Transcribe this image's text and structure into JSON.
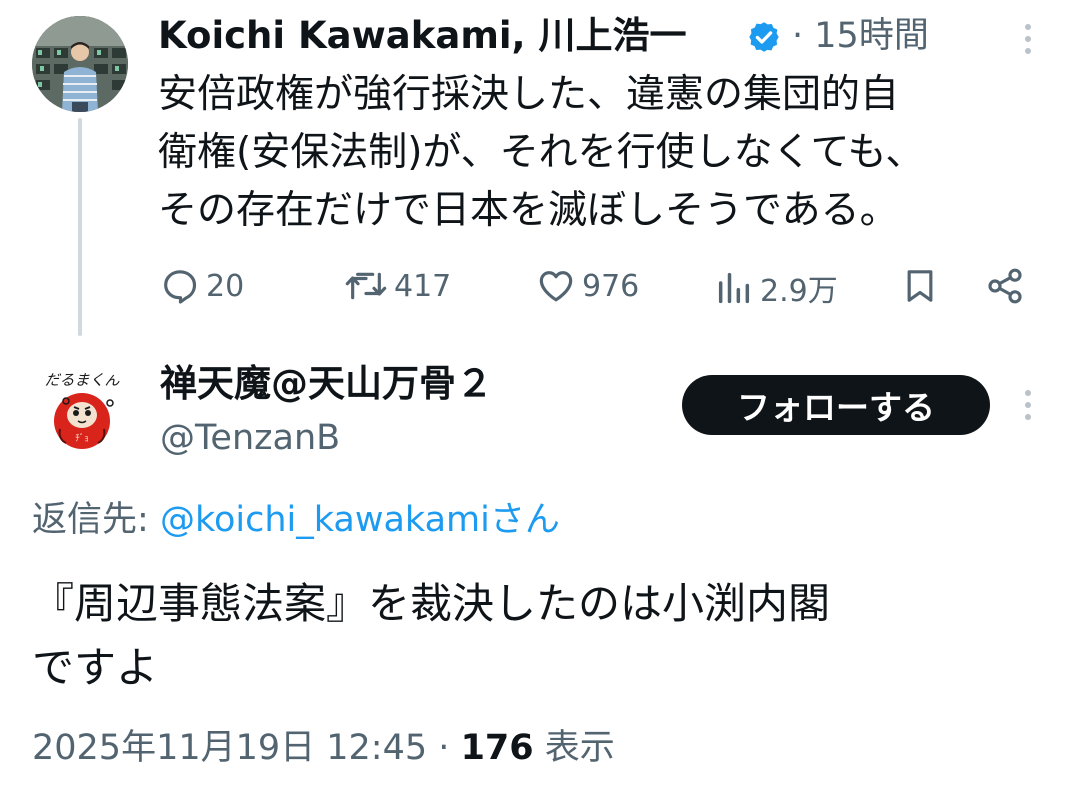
{
  "parent_tweet": {
    "author_name": "Koichi Kawakami, 川上浩一",
    "verified": true,
    "time_separator": "·",
    "time": "15時間",
    "text_lines": [
      "安倍政権が強行採決した、違憲の集団的自",
      "衛権(安保法制)が、それを行使しなくても、",
      "その存在だけで日本を滅ぼしそうである。"
    ],
    "actions": {
      "replies": "20",
      "retweets": "417",
      "likes": "976",
      "views": "2.9万"
    },
    "icons": [
      "reply-icon",
      "retweet-icon",
      "like-icon",
      "views-icon",
      "bookmark-icon",
      "share-icon",
      "verified-badge-icon",
      "more-icon"
    ],
    "accent_color": "#1d9bf0"
  },
  "reply_tweet": {
    "author_name": "禅天魔@天山万骨２",
    "handle": "@TenzanB",
    "follow_label": "フォローする",
    "reply_to_label": "返信先:",
    "reply_to_mention": "@koichi_kawakamiさん",
    "text_lines": [
      "『周辺事態法案』を裁決したのは小渕内閣",
      "ですよ"
    ],
    "timestamp": "2025年11月19日 12:45",
    "meta_separator": "·",
    "views_count": "176",
    "views_label": "表示",
    "avatar_lettering": "だるまくん"
  }
}
